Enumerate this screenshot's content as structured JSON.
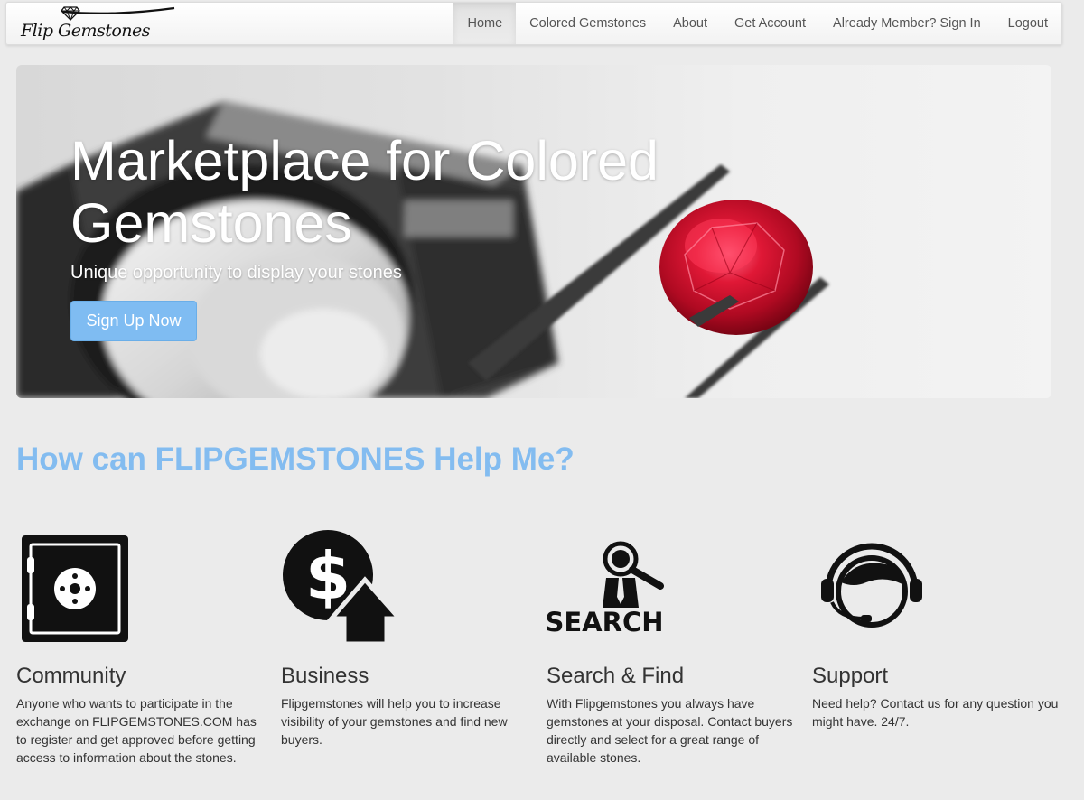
{
  "brand": {
    "name": "Flip Gemstones"
  },
  "nav": {
    "items": [
      {
        "label": "Home",
        "active": true
      },
      {
        "label": "Colored Gemstones"
      },
      {
        "label": "About"
      },
      {
        "label": "Get Account"
      },
      {
        "label": "Already Member? Sign In"
      },
      {
        "label": "Logout"
      }
    ]
  },
  "hero": {
    "title": "Marketplace for Colored Gemstones",
    "subtitle": "Unique opportunity to display your stones",
    "cta_label": "Sign Up Now"
  },
  "section": {
    "heading": "How can FLIPGEMSTONES Help Me?"
  },
  "features": [
    {
      "icon": "safe-icon",
      "title": "Community",
      "text": "Anyone who wants to participate in the exchange on FLIPGEMSTONES.COM has to register and get approved before getting access to information about the stones."
    },
    {
      "icon": "dollar-up-icon",
      "title": "Business",
      "text": "Flipgemstones will help you to increase visibility of your gemstones and find new buyers."
    },
    {
      "icon": "search-person-icon",
      "title": "Search & Find",
      "icon_text": "SEARCH",
      "text": "With Flipgemstones you always have gemstones at your disposal. Contact buyers directly and select for a great range of available stones."
    },
    {
      "icon": "headset-support-icon",
      "title": "Support",
      "text": "Need help? Contact us for any question you might have. 24/7."
    }
  ],
  "colors": {
    "accent": "#83bcf0",
    "button": "#7fbcf2",
    "background": "#ebebeb",
    "ruby": "#d8102a"
  }
}
